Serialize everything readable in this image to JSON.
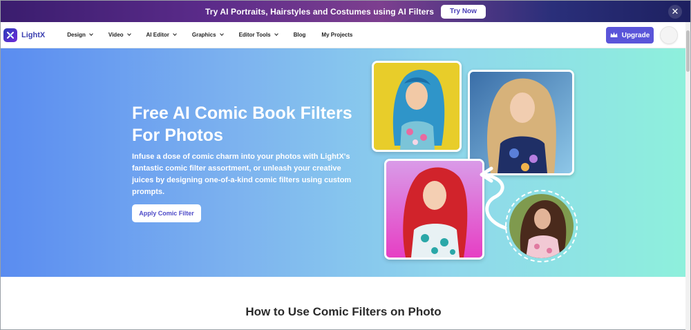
{
  "promo": {
    "text": "Try AI Portraits, Hairstyles and Costumes using AI Filters",
    "button": "Try Now",
    "close": "✕"
  },
  "nav": {
    "logo_text": "LightX",
    "items": [
      {
        "label": "Design",
        "dropdown": true
      },
      {
        "label": "Video",
        "dropdown": true
      },
      {
        "label": "AI Editor",
        "dropdown": true
      },
      {
        "label": "Graphics",
        "dropdown": true
      },
      {
        "label": "Editor Tools",
        "dropdown": true
      },
      {
        "label": "Blog",
        "dropdown": false
      },
      {
        "label": "My Projects",
        "dropdown": false
      }
    ],
    "upgrade": "Upgrade"
  },
  "hero": {
    "title_line1": "Free AI Comic Book Filters",
    "title_line2": "For Photos",
    "description": "Infuse a dose of comic charm into your photos with LightX's fantastic comic filter assortment, or unleash your creative juices by designing one-of-a-kind comic filters using custom prompts.",
    "button": "Apply Comic Filter"
  },
  "section": {
    "title": "How to Use Comic Filters on Photo"
  },
  "colors": {
    "accent": "#5a55d9",
    "banner_start": "#3a1d6e",
    "hero_left": "#5a8cf0",
    "hero_right": "#8ef0dc"
  }
}
